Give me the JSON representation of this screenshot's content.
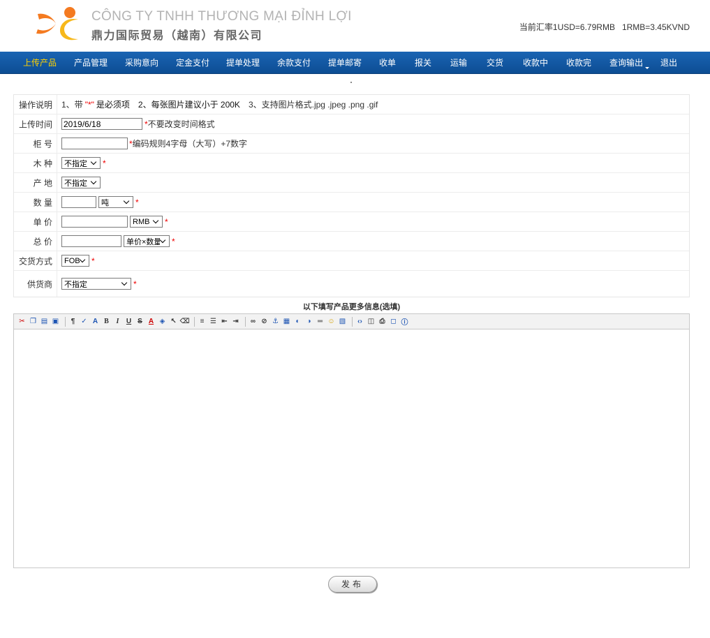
{
  "header": {
    "company_en": "CÔNG TY TNHH THƯƠNG MẠI ĐỈNH LỢI",
    "company_cn": "鼎力国际贸易（越南）有限公司",
    "rate_label": "当前汇率",
    "rate_usd": "1USD=6.79RMB",
    "rate_vnd": "1RMB=3.45KVND",
    "logo_colors": {
      "orange": "#f47a20",
      "yellow": "#f7b81b"
    }
  },
  "nav": {
    "items": [
      {
        "label": "上传产品",
        "active": true
      },
      {
        "label": "产品管理"
      },
      {
        "label": "采购意向"
      },
      {
        "label": "定金支付"
      },
      {
        "label": "提单处理"
      },
      {
        "label": "余款支付"
      },
      {
        "label": "提单邮寄"
      },
      {
        "label": "收单"
      },
      {
        "label": "报关"
      },
      {
        "label": "运输"
      },
      {
        "label": "交货"
      },
      {
        "label": "收款中"
      },
      {
        "label": "收款完"
      },
      {
        "label": "查询输出"
      },
      {
        "label": "退出"
      }
    ],
    "bg_color": "#1058a8",
    "active_color": "#ffd200"
  },
  "form": {
    "instructions": {
      "label": "操作说明",
      "part1_prefix": "1、带",
      "part1_star": "\"*\"",
      "part1_suffix": "是必须项",
      "part2": "2、每张图片建议小于 200K",
      "part3": "3、支持图片格式.jpg .jpeg .png .gif"
    },
    "upload_time": {
      "label": "上传时间",
      "value": "2019/6/18",
      "hint": "不要改变时间格式"
    },
    "container_no": {
      "label": "柜 号",
      "value": "",
      "hint": "编码规则4字母（大写）+7数字"
    },
    "wood_type": {
      "label": "木 种",
      "selected": "不指定"
    },
    "origin": {
      "label": "产 地",
      "selected": "不指定"
    },
    "quantity": {
      "label": "数 量",
      "value": "",
      "unit": "吨"
    },
    "unit_price": {
      "label": "单 价",
      "value": "",
      "currency": "RMB"
    },
    "total_price": {
      "label": "总 价",
      "value": "",
      "calc": "单价×数量"
    },
    "delivery": {
      "label": "交货方式",
      "selected": "FOB"
    },
    "supplier": {
      "label": "供货商",
      "selected": "不指定"
    },
    "required_mark": "*"
  },
  "more_info": {
    "title": "以下填写产品更多信息(选填)"
  },
  "editor": {
    "toolbar": [
      "cut-icon",
      "copy-icon",
      "paste-icon",
      "paste-word-icon",
      "separator",
      "format-icon",
      "spellcheck-icon",
      "font-size-icon",
      "bold-icon",
      "italic-icon",
      "underline-icon",
      "strike-icon",
      "font-color-icon",
      "bg-color-icon",
      "select-icon",
      "eraser-icon",
      "separator",
      "align-icon",
      "ordered-list-icon",
      "outdent-icon",
      "indent-icon",
      "separator",
      "link-icon",
      "unlink-icon",
      "anchor-icon",
      "image-icon",
      "flash-icon",
      "media-icon",
      "hr-icon",
      "emoticon-icon",
      "table-icon",
      "separator",
      "source-icon",
      "preview-icon",
      "print-icon",
      "fullscreen-icon",
      "about-icon"
    ]
  },
  "actions": {
    "publish_label": "发布"
  }
}
